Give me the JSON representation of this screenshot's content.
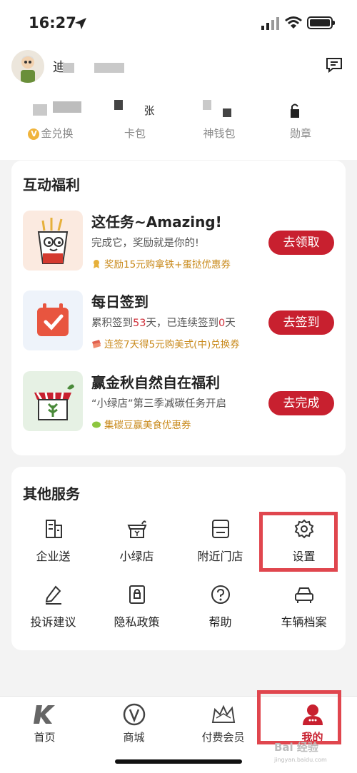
{
  "status_bar": {
    "time": "16:27"
  },
  "user": {
    "name": "迪"
  },
  "stats": {
    "items": [
      {
        "top": "",
        "label": "金兑换"
      },
      {
        "top": "张",
        "label": "卡包"
      },
      {
        "top": "",
        "label": "神钱包"
      },
      {
        "top": "",
        "label": "勋章"
      }
    ]
  },
  "welfare": {
    "title": "互动福利",
    "tasks": [
      {
        "title": "这任务~Amazing!",
        "desc": "完成它，奖励就是你的!",
        "reward": "奖励15元购拿铁+蛋挞优惠券",
        "button": "去领取"
      },
      {
        "title": "每日签到",
        "desc_prefix": "累积签到",
        "desc_num1": "53",
        "desc_mid": "天，已连续签到",
        "desc_num2": "0",
        "desc_suffix": "天",
        "reward": "连签7天得5元购美式(中)兑换券",
        "button": "去签到"
      },
      {
        "title": "赢金秋自然自在福利",
        "desc": "“小绿店”第三季减碳任务开启",
        "reward": "集碳豆赢美食优惠券",
        "button": "去完成"
      }
    ]
  },
  "services": {
    "title": "其他服务",
    "items": [
      {
        "label": "企业送",
        "icon": "building-icon"
      },
      {
        "label": "小绿店",
        "icon": "green-store-icon"
      },
      {
        "label": "附近门店",
        "icon": "store-icon"
      },
      {
        "label": "设置",
        "icon": "gear-icon"
      },
      {
        "label": "投诉建议",
        "icon": "feedback-icon"
      },
      {
        "label": "隐私政策",
        "icon": "privacy-icon"
      },
      {
        "label": "帮助",
        "icon": "help-icon"
      },
      {
        "label": "车辆档案",
        "icon": "car-icon"
      }
    ]
  },
  "tabbar": {
    "items": [
      {
        "label": "首页",
        "icon": "k-logo-icon"
      },
      {
        "label": "商城",
        "icon": "mall-icon"
      },
      {
        "label": "付费会员",
        "icon": "crown-icon"
      },
      {
        "label": "我的",
        "icon": "person-icon",
        "active": true
      }
    ]
  },
  "watermark": {
    "text": "Bai 经验",
    "sub": "jingyan.baidu.com"
  },
  "colors": {
    "accent": "#c8202f",
    "highlight": "#e0464e",
    "reward": "#c8891a"
  }
}
